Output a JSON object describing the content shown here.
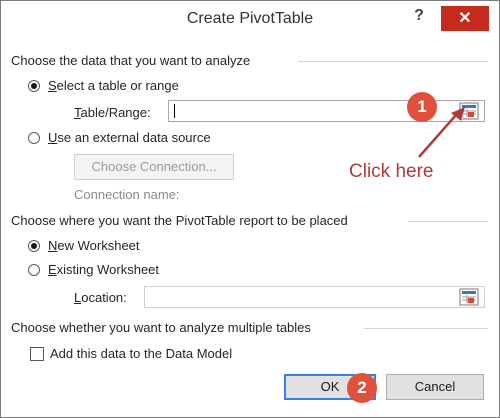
{
  "window": {
    "title": "Create PivotTable",
    "help_label": "?",
    "close_label": "✕"
  },
  "section_data": {
    "heading": "Choose the data that you want to analyze",
    "select_table": {
      "prefix": "",
      "accesskey": "S",
      "rest": "elect a table or range",
      "selected": true
    },
    "table_range": {
      "accesskey": "T",
      "rest": "able/Range:",
      "value": ""
    },
    "external": {
      "accesskey": "U",
      "rest": "se an external data source",
      "selected": false
    },
    "choose_connection_label": "Choose Connection...",
    "connection_name_label": "Connection name:"
  },
  "section_place": {
    "heading": "Choose where you want the PivotTable report to be placed",
    "new_ws": {
      "accesskey": "N",
      "rest": "ew Worksheet",
      "selected": true
    },
    "existing_ws": {
      "accesskey": "E",
      "rest": "xisting Worksheet",
      "selected": false
    },
    "location": {
      "accesskey": "L",
      "rest": "ocation:",
      "value": ""
    }
  },
  "section_multi": {
    "heading": "Choose whether you want to analyze multiple tables",
    "data_model_label": "Add this data to the Data Model",
    "data_model_checked": false
  },
  "buttons": {
    "ok": "OK",
    "cancel": "Cancel"
  },
  "annotations": {
    "badge1": "1",
    "badge2": "2",
    "click_here": "Click here",
    "accent_color": "#e0503c",
    "arrow_color": "#b03a3a"
  },
  "icons": {
    "range_picker": "range-picker-icon",
    "radio": "radio-button",
    "checkbox": "checkbox"
  }
}
